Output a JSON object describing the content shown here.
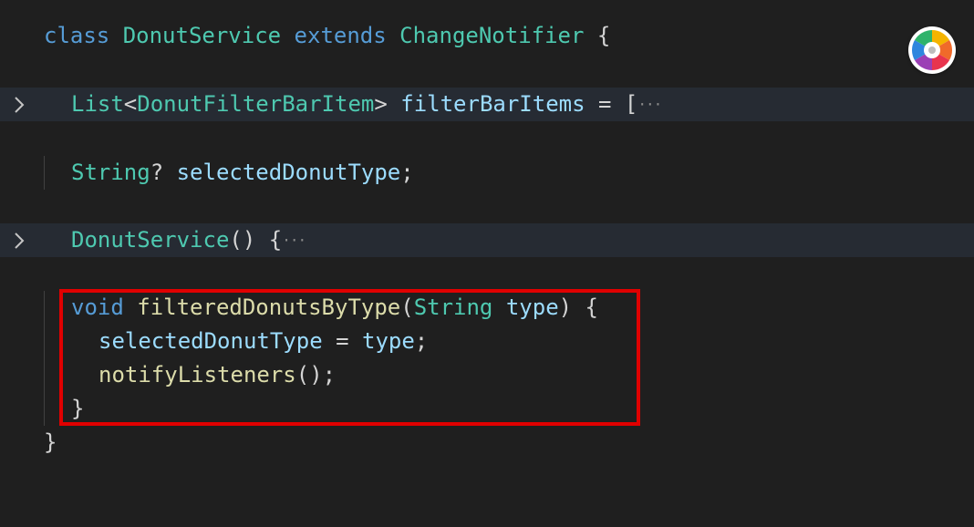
{
  "editor": {
    "line1": {
      "kw_class": "class",
      "class_name": "DonutService",
      "kw_extends": "extends",
      "parent": "ChangeNotifier",
      "brace": " {"
    },
    "line2": {
      "type_list": "List",
      "lt": "<",
      "type_item": "DonutFilterBarItem",
      "gt": ">",
      "field": "filterBarItems",
      "assign": " = [",
      "ellipsis": "···"
    },
    "line3": {
      "type_string": "String",
      "q": "? ",
      "field": "selectedDonutType",
      "semi": ";"
    },
    "line4": {
      "ctor": "DonutService",
      "rest": "() {",
      "ellipsis": "···"
    },
    "line5": {
      "kw_void": "void",
      "method": "filteredDonutsByType",
      "paren_open": "(",
      "param_type": "String",
      "param_name": "type",
      "paren_close": ") {"
    },
    "line6": {
      "target": "selectedDonutType",
      "assign": " = ",
      "value": "type",
      "semi": ";"
    },
    "line7": {
      "call": "notifyListeners",
      "rest": "();"
    },
    "line8": {
      "brace": "}"
    },
    "line9": {
      "brace": "}"
    }
  },
  "colors": {
    "keyword": "#569cd6",
    "type": "#4ec9b0",
    "function": "#dcdcaa",
    "variable": "#9cdcfe",
    "punctuation": "#d4d4d4",
    "highlight_border": "#e00000",
    "background": "#1f1f1f"
  },
  "icons": {
    "fold_chevron": "chevron-right-icon",
    "color_wheel": "color-wheel-icon"
  }
}
